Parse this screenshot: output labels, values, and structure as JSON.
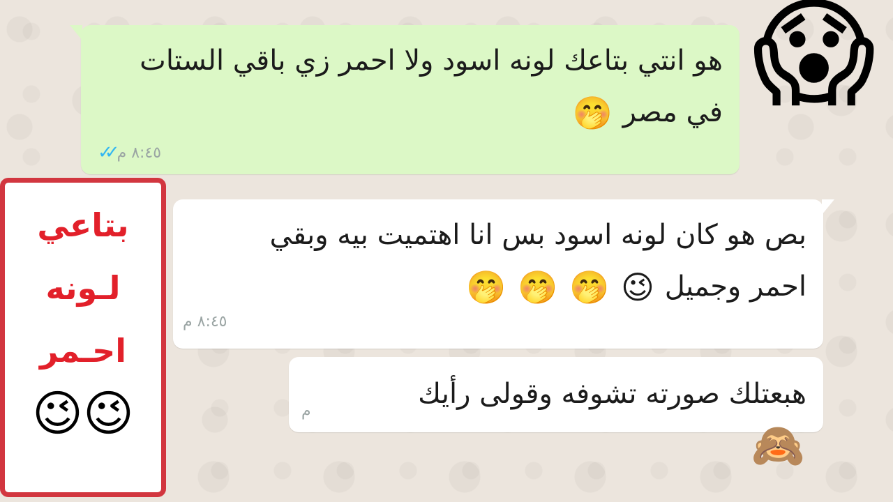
{
  "messages": [
    {
      "direction": "outgoing",
      "line1": "هو انتي بتاعك لونه اسود ولا احمر زي باقي الستات",
      "line2": "في مصر",
      "emojis": [
        "🤭"
      ],
      "time": "٨:٤٥ م",
      "ticks": "✓✓"
    },
    {
      "direction": "incoming",
      "line1": "بص هو كان لونه اسود بس انا اهتميت بيه وبقي",
      "line2": "احمر وجميل",
      "emojis": [
        "😉",
        "🤭",
        "🤭",
        "🤭"
      ],
      "time": "٨:٤٥ م"
    },
    {
      "direction": "incoming",
      "line1": "هبعتلك صورته تشوفه وقولى رأيك",
      "emojis": [
        "🙈"
      ],
      "time": "م"
    }
  ],
  "overlay": {
    "big_emoji": "😱",
    "side_lines": [
      "بتاعي",
      "لـونه",
      "احـمر"
    ],
    "side_emojis": [
      "😉",
      "😉"
    ]
  },
  "colors": {
    "outgoing_bubble": "#dcf8c6",
    "incoming_bubble": "#ffffff",
    "panel_border": "#d2363f",
    "panel_text": "#e2202a",
    "read_ticks": "#34b7f1"
  }
}
